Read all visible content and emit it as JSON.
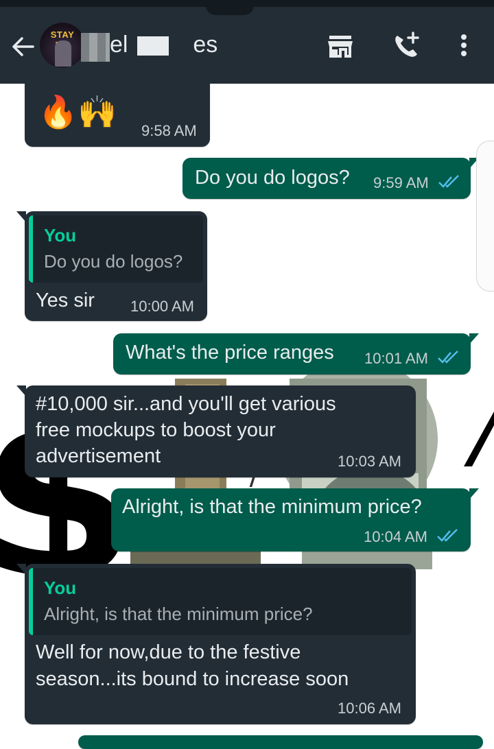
{
  "header": {
    "avatar_text": "STAY FIT",
    "title_part1": "el",
    "title_part2": "es",
    "icons": [
      "back-arrow-icon",
      "store-icon",
      "add-call-icon",
      "more-vert-icon"
    ]
  },
  "colors": {
    "header_bg": "#232d36",
    "incoming_bubble": "#232d36",
    "outgoing_bubble": "#005c4b",
    "quote_accent": "#06cf9c",
    "read_ticks": "#53bdeb"
  },
  "messages": [
    {
      "direction": "in",
      "emoji": "🔥🙌",
      "time": "9:58 AM"
    },
    {
      "direction": "out",
      "text": "Do you do logos?",
      "time": "9:59 AM",
      "status": "read"
    },
    {
      "direction": "in",
      "quote_author": "You",
      "quote_text": "Do you do logos?",
      "text": "Yes sir",
      "time": "10:00 AM"
    },
    {
      "direction": "out",
      "text": "What's the price ranges",
      "time": "10:01 AM",
      "status": "read"
    },
    {
      "direction": "in",
      "lines": [
        "#10,000 sir...and you'll get various",
        "free mockups to boost your",
        "advertisement"
      ],
      "time": "10:03 AM"
    },
    {
      "direction": "out",
      "text": "Alright, is that the minimum price?",
      "time": "10:04 AM",
      "status": "read"
    },
    {
      "direction": "in",
      "quote_author": "You",
      "quote_text": "Alright, is that the minimum price?",
      "lines": [
        "Well for now,due to the festive",
        "season...its bound to increase soon"
      ],
      "time": "10:06 AM"
    }
  ]
}
